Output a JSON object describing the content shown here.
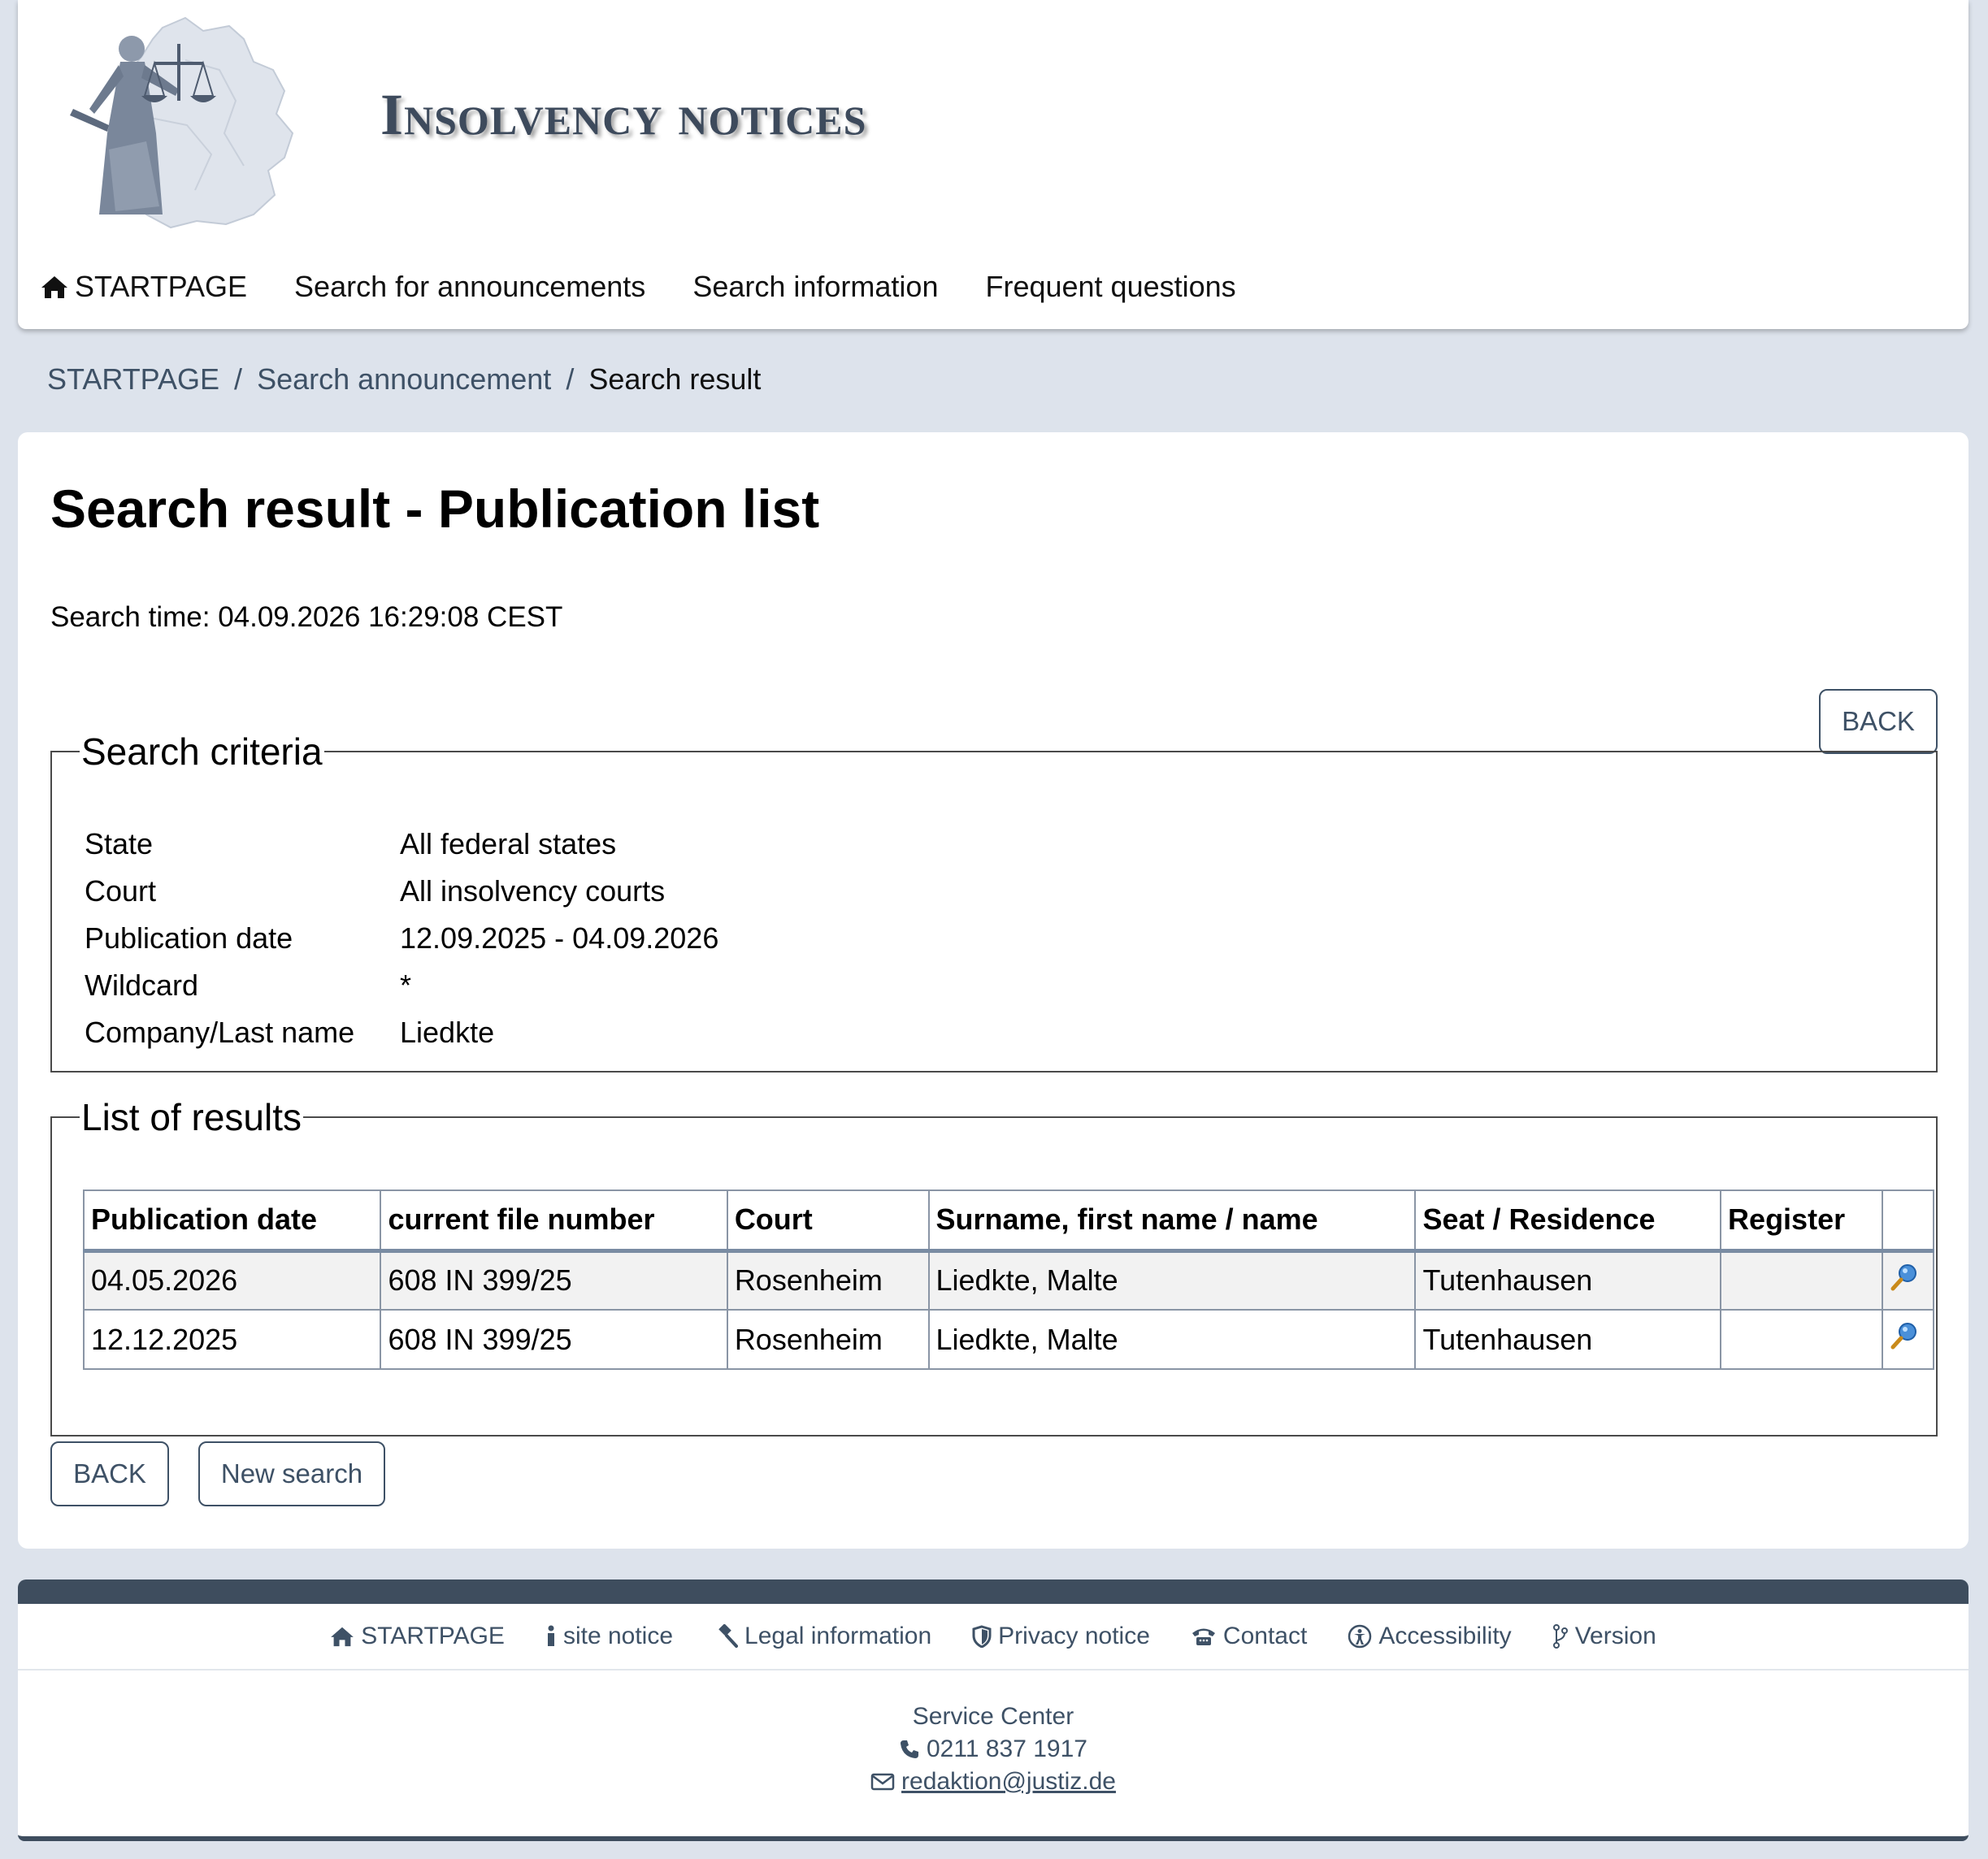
{
  "header": {
    "site_title": "Insolvency notices",
    "logo_icon": "justitia-map-logo"
  },
  "nav": {
    "items": [
      {
        "label": "STARTPAGE",
        "icon": "home-icon"
      },
      {
        "label": "Search for announcements"
      },
      {
        "label": "Search information"
      },
      {
        "label": "Frequent questions"
      }
    ]
  },
  "breadcrumb": {
    "items": [
      "STARTPAGE",
      "Search announcement"
    ],
    "separator": "/",
    "current": "Search result"
  },
  "main": {
    "title": "Search result - Publication list",
    "search_time": "Search time: 04.09.2026 16:29:08 CEST",
    "back_label": "BACK",
    "new_search_label": "New search"
  },
  "criteria": {
    "legend": "Search criteria",
    "rows": [
      {
        "label": "State",
        "value": "All federal states"
      },
      {
        "label": "Court",
        "value": "All insolvency courts"
      },
      {
        "label": "Publication date",
        "value": "12.09.2025 - 04.09.2026"
      },
      {
        "label": "Wildcard",
        "value": "*"
      },
      {
        "label": "Company/Last name",
        "value": "Liedkte"
      }
    ]
  },
  "results": {
    "legend": "List of results",
    "columns": [
      "Publication date",
      "current file number",
      "Court",
      "Surname, first name / name",
      "Seat / Residence",
      "Register",
      ""
    ],
    "rows": [
      {
        "date": "04.05.2026",
        "file_number": "608 IN 399/25",
        "court": "Rosenheim",
        "name": "Liedkte, Malte",
        "seat": "Tutenhausen",
        "register": ""
      },
      {
        "date": "12.12.2025",
        "file_number": "608 IN 399/25",
        "court": "Rosenheim",
        "name": "Liedkte, Malte",
        "seat": "Tutenhausen",
        "register": ""
      }
    ],
    "row_action_icon": "magnifier-icon"
  },
  "footer": {
    "links": [
      {
        "label": "STARTPAGE",
        "icon": "home-icon"
      },
      {
        "label": "site notice",
        "icon": "info-icon"
      },
      {
        "label": "Legal information",
        "icon": "gavel-icon"
      },
      {
        "label": "Privacy notice",
        "icon": "shield-icon"
      },
      {
        "label": "Contact",
        "icon": "telephone-icon"
      },
      {
        "label": "Accessibility",
        "icon": "accessibility-icon"
      },
      {
        "label": "Version",
        "icon": "code-branch-icon"
      }
    ],
    "service_center": "Service Center",
    "phone": "0211 837 1917",
    "email": "redaktion@justiz.de"
  },
  "colors": {
    "page_background": "#dde3ec",
    "accent": "#3e5166",
    "footer_bar": "#3e4d5e",
    "title_color": "#3d4a5c"
  }
}
